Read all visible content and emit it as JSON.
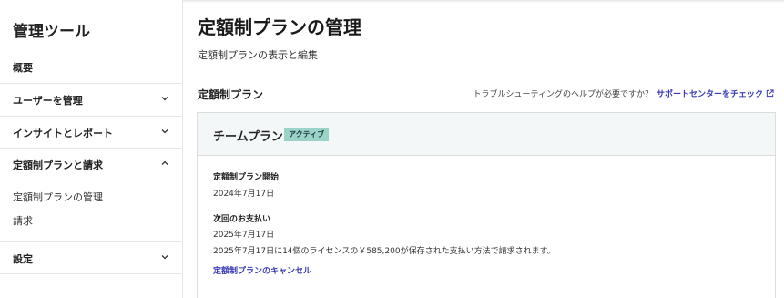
{
  "sidebar": {
    "title": "管理ツール",
    "overview": "概要",
    "sections": [
      {
        "label": "ユーザーを管理",
        "expanded": false
      },
      {
        "label": "インサイトとレポート",
        "expanded": false
      },
      {
        "label": "定額制プランと請求",
        "expanded": true
      },
      {
        "label": "設定",
        "expanded": false
      }
    ],
    "subitems": [
      "定額制プランの管理",
      "請求"
    ]
  },
  "main": {
    "title": "定額制プランの管理",
    "subtitle": "定額制プランの表示と編集",
    "section_title": "定額制プラン",
    "help_text": "トラブルシューティングのヘルプが必要ですか？",
    "help_link": "サポートセンターをチェック",
    "card": {
      "plan_name": "チームプラン",
      "status_badge": "アクティブ",
      "start_label": "定額制プラン開始",
      "start_value": "2024年7月17日",
      "next_payment_label": "次回のお支払い",
      "next_payment_date": "2025年7月17日",
      "next_payment_note": "2025年7月17日に14個のライセンスの￥585,200が保存された支払い方法で請求されます。",
      "cancel_link": "定額制プランのキャンセル"
    }
  },
  "colors": {
    "link": "#3a3ab8",
    "badge_bg": "#9bd3c9",
    "card_header_bg": "#f3f7f7"
  }
}
